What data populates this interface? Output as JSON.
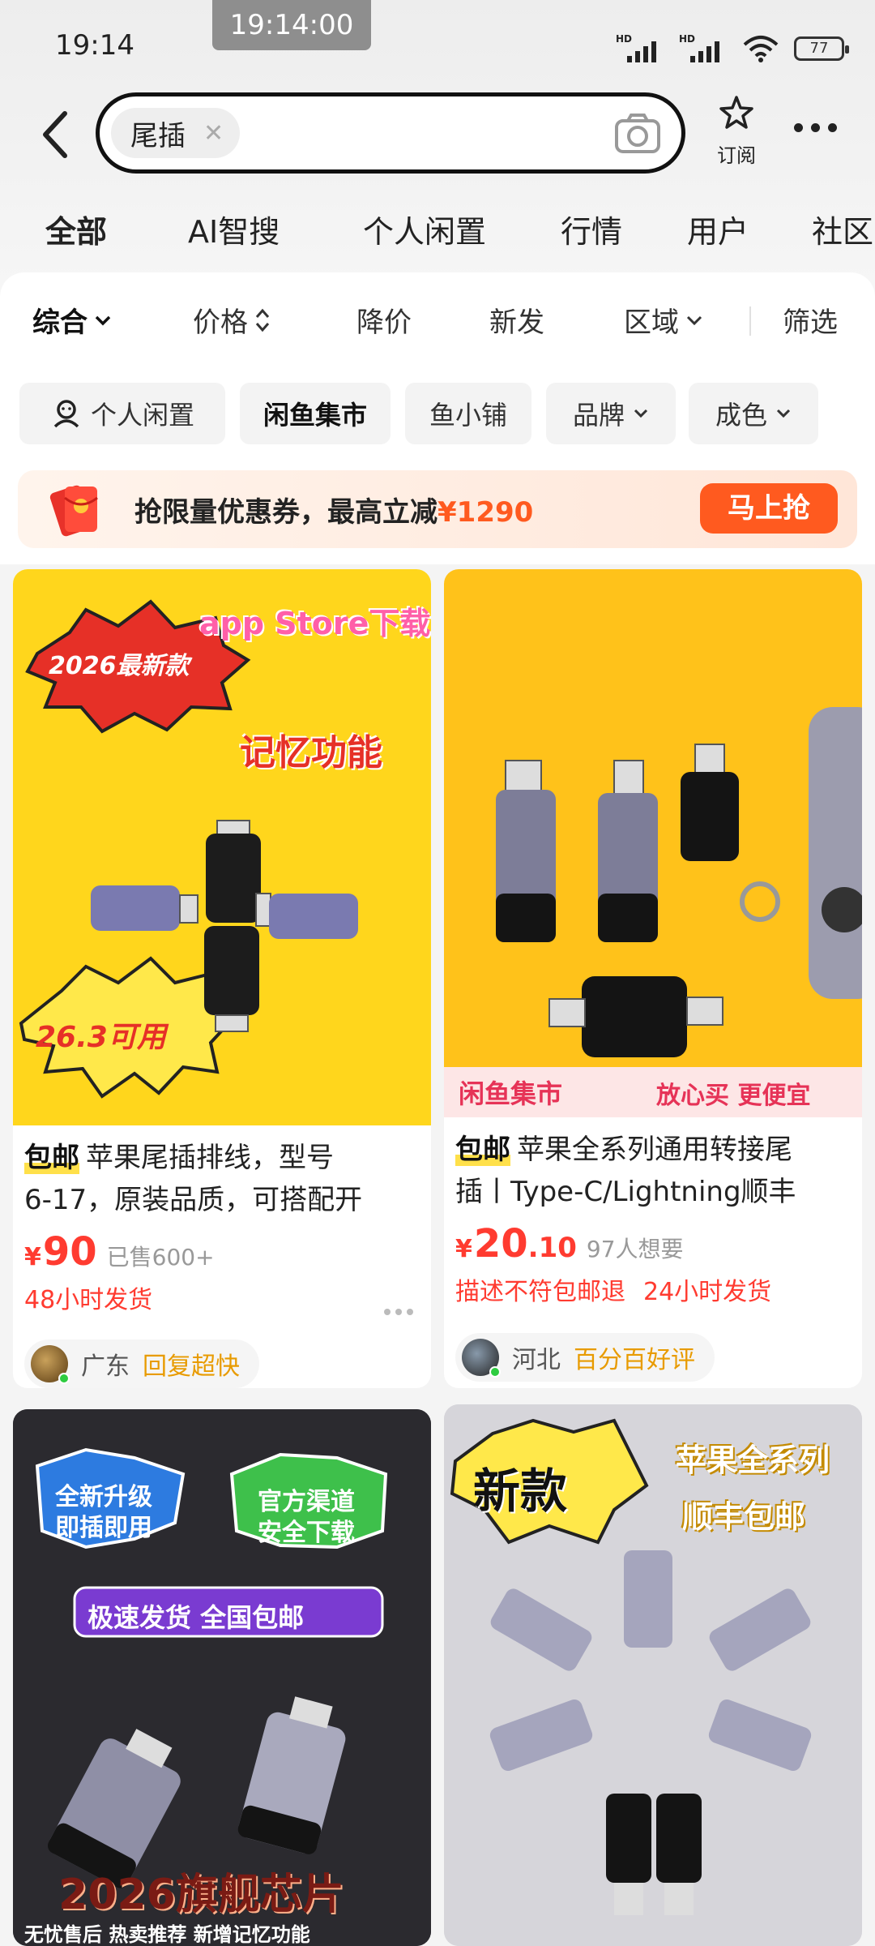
{
  "status_bar": {
    "time": "19:14",
    "clock_overlay": "19:14:00",
    "battery": "77",
    "signal_1_label": "HD",
    "signal_2_label": "HD"
  },
  "search": {
    "query": "尾插",
    "subscribe_label": "订阅"
  },
  "category_tabs": [
    {
      "label": "全部",
      "active": true
    },
    {
      "label": "AI智搜"
    },
    {
      "label": "个人闲置"
    },
    {
      "label": "行情"
    },
    {
      "label": "用户"
    },
    {
      "label": "社区"
    }
  ],
  "sort_options": [
    {
      "label": "综合",
      "active": true
    },
    {
      "label": "价格"
    },
    {
      "label": "降价"
    },
    {
      "label": "新发"
    },
    {
      "label": "区域"
    },
    {
      "label": "筛选"
    }
  ],
  "filter_chips": [
    {
      "label": "个人闲置"
    },
    {
      "label": "闲鱼集市"
    },
    {
      "label": "鱼小铺"
    },
    {
      "label": "品牌"
    },
    {
      "label": "成色"
    }
  ],
  "coupon": {
    "text": "抢限量优惠券，最高立减",
    "amount": "¥1290",
    "button": "马上抢"
  },
  "products": [
    {
      "badge": "包邮",
      "title_line1": "苹果尾插排线，型号",
      "title_line2": "6-17，原装品质，可搭配开",
      "price": "90",
      "sold": "已售600+",
      "tags": [
        "48小时发货"
      ],
      "location": "广东",
      "seller_tag": "回复超快",
      "image_texts": {
        "top": "app Store下载",
        "burst": "2026最新款",
        "feature": "记忆功能",
        "bottom": "26.3可用"
      }
    },
    {
      "badge": "包邮",
      "title_line1": "苹果全系列通用转接尾",
      "title_line2": "插丨Type-C/Lightning顺丰",
      "price": "20",
      "price_cents": ".10",
      "sold": "97人想要",
      "tags": [
        "描述不符包邮退",
        "24小时发货"
      ],
      "location": "河北",
      "seller_tag": "百分百好评",
      "image_texts": {
        "banner_left": "闲鱼集市",
        "banner_right": "放心买 更便宜"
      }
    },
    {
      "image_texts": {
        "bubble1": "全新升级 即插即用",
        "bubble2": "官方渠道 安全下载",
        "strip": "极速发货 全国包邮",
        "big": "2026旗舰芯片",
        "footer": "无忧售后 热卖推荐 新增记忆功能"
      }
    },
    {
      "image_texts": {
        "burst": "新款",
        "line1": "苹果全系列",
        "line2": "顺丰包邮"
      }
    }
  ],
  "colors": {
    "accent": "#ff5a1f",
    "price": "#ff3b30",
    "highlight": "#ffe04a",
    "seller_tag": "#e89b00"
  }
}
